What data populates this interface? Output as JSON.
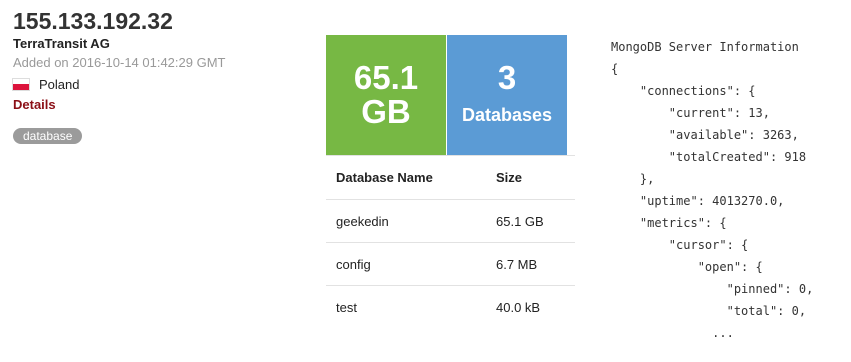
{
  "host": {
    "ip": "155.133.192.32",
    "organization": "TerraTransit AG",
    "added": "Added on 2016-10-14 01:42:29 GMT",
    "country": "Poland",
    "details_label": "Details",
    "tag": "database",
    "flag_colors": [
      "#ffffff",
      "#dc143c"
    ]
  },
  "stats": {
    "size_value": "65.1",
    "size_unit": "GB",
    "size_color": "#77b844",
    "db_count": "3",
    "db_label": "Databases",
    "db_color": "#5b9bd5"
  },
  "databases": {
    "headers": [
      "Database Name",
      "Size"
    ],
    "rows": [
      {
        "name": "geekedin",
        "size": "65.1 GB"
      },
      {
        "name": "config",
        "size": "6.7 MB"
      },
      {
        "name": "test",
        "size": "40.0 kB"
      }
    ]
  },
  "server_info": {
    "lines": [
      "MongoDB Server Information",
      "{",
      "    \"connections\": {",
      "        \"current\": 13,",
      "        \"available\": 3263,",
      "        \"totalCreated\": 918",
      "    },",
      "    \"uptime\": 4013270.0,",
      "    \"metrics\": {",
      "        \"cursor\": {",
      "            \"open\": {",
      "                \"pinned\": 0,",
      "                \"total\": 0,",
      "              ..."
    ]
  }
}
